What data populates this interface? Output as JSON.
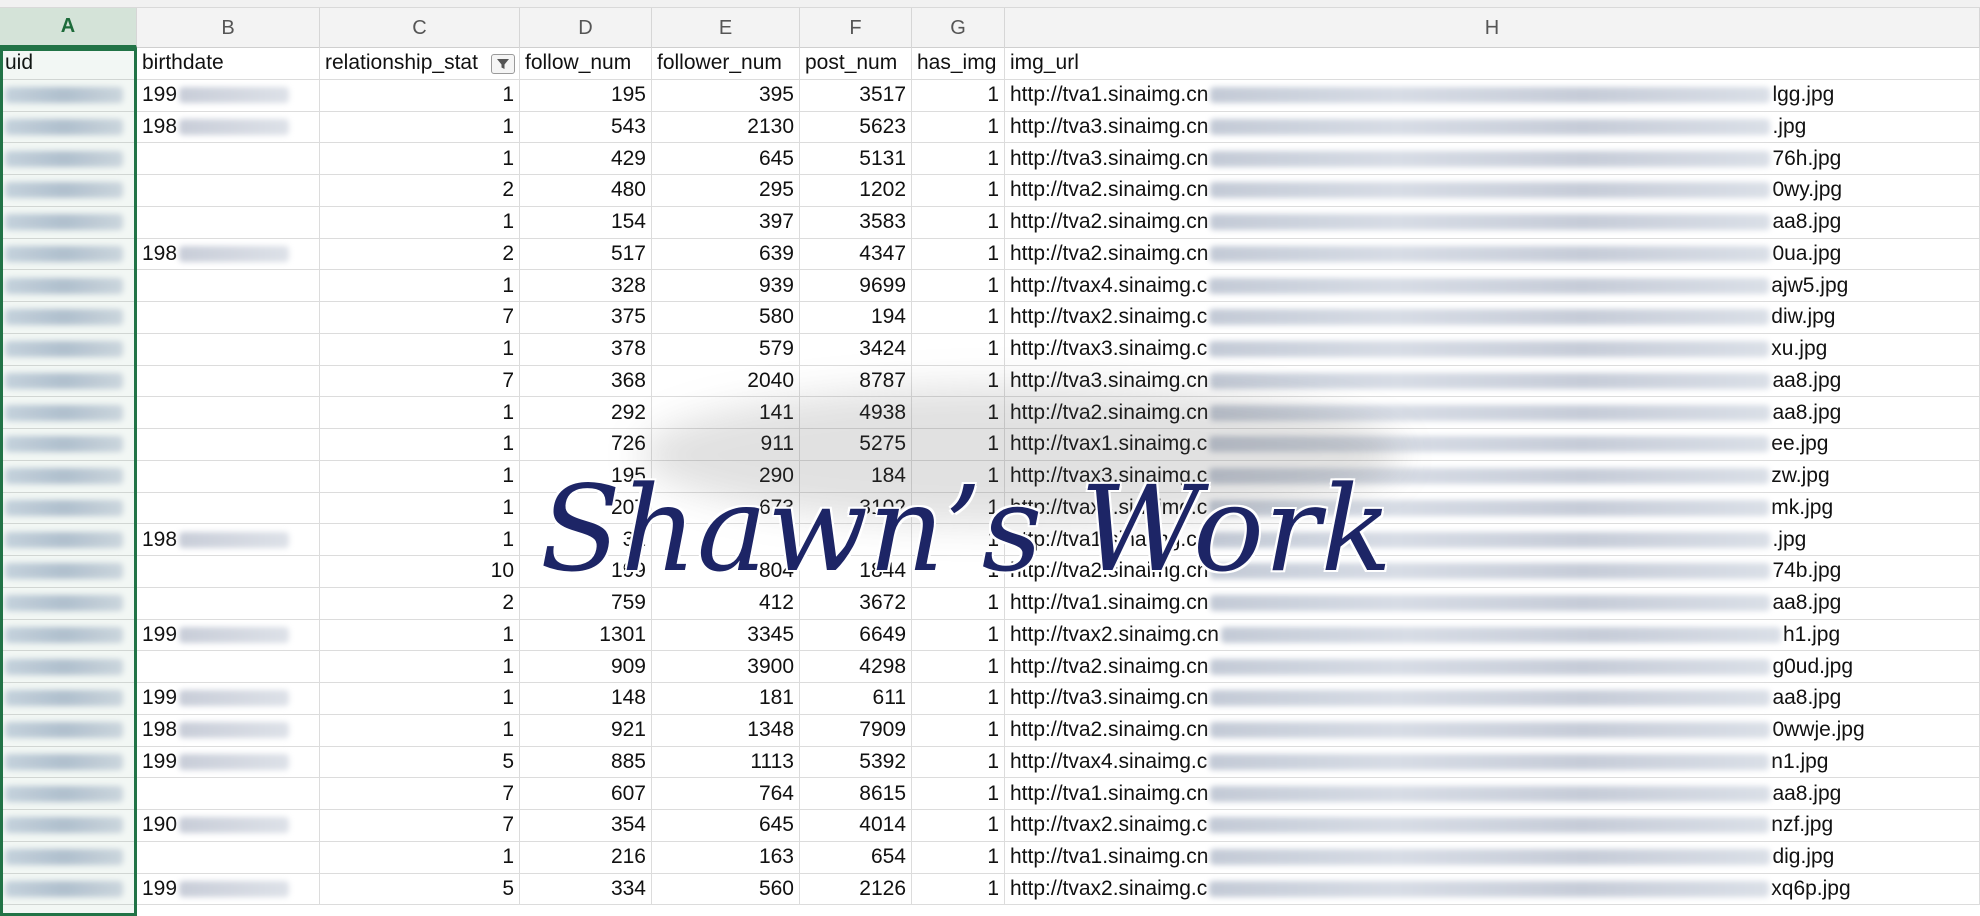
{
  "column_letters": [
    "A",
    "B",
    "C",
    "D",
    "E",
    "F",
    "G",
    "H"
  ],
  "headers": [
    "uid",
    "birthdate",
    "relationship_stat",
    "follow_num",
    "follower_num",
    "post_num",
    "has_img",
    "img_url"
  ],
  "rows": [
    {
      "birth": "199",
      "rel": "1",
      "follow": "195",
      "follower": "395",
      "post": "3517",
      "has_img": "1",
      "url_host": "http://tva1.sinaimg.cn",
      "url_tail": "lgg.jpg"
    },
    {
      "birth": "198",
      "rel": "1",
      "follow": "543",
      "follower": "2130",
      "post": "5623",
      "has_img": "1",
      "url_host": "http://tva3.sinaimg.cn",
      "url_tail": ".jpg"
    },
    {
      "birth": "",
      "rel": "1",
      "follow": "429",
      "follower": "645",
      "post": "5131",
      "has_img": "1",
      "url_host": "http://tva3.sinaimg.cn",
      "url_tail": "76h.jpg"
    },
    {
      "birth": "",
      "rel": "2",
      "follow": "480",
      "follower": "295",
      "post": "1202",
      "has_img": "1",
      "url_host": "http://tva2.sinaimg.cn",
      "url_tail": "0wy.jpg"
    },
    {
      "birth": "",
      "rel": "1",
      "follow": "154",
      "follower": "397",
      "post": "3583",
      "has_img": "1",
      "url_host": "http://tva2.sinaimg.cn",
      "url_tail": "aa8.jpg"
    },
    {
      "birth": "198",
      "rel": "2",
      "follow": "517",
      "follower": "639",
      "post": "4347",
      "has_img": "1",
      "url_host": "http://tva2.sinaimg.cn",
      "url_tail": "0ua.jpg"
    },
    {
      "birth": "",
      "rel": "1",
      "follow": "328",
      "follower": "939",
      "post": "9699",
      "has_img": "1",
      "url_host": "http://tvax4.sinaimg.c",
      "url_tail": "ajw5.jpg"
    },
    {
      "birth": "",
      "rel": "7",
      "follow": "375",
      "follower": "580",
      "post": "194",
      "has_img": "1",
      "url_host": "http://tvax2.sinaimg.c",
      "url_tail": "diw.jpg"
    },
    {
      "birth": "",
      "rel": "1",
      "follow": "378",
      "follower": "579",
      "post": "3424",
      "has_img": "1",
      "url_host": "http://tvax3.sinaimg.c",
      "url_tail": "xu.jpg"
    },
    {
      "birth": "",
      "rel": "7",
      "follow": "368",
      "follower": "2040",
      "post": "8787",
      "has_img": "1",
      "url_host": "http://tva3.sinaimg.cn",
      "url_tail": "aa8.jpg"
    },
    {
      "birth": "",
      "rel": "1",
      "follow": "292",
      "follower": "141",
      "post": "4938",
      "has_img": "1",
      "url_host": "http://tva2.sinaimg.cn",
      "url_tail": "aa8.jpg"
    },
    {
      "birth": "",
      "rel": "1",
      "follow": "726",
      "follower": "911",
      "post": "5275",
      "has_img": "1",
      "url_host": "http://tvax1.sinaimg.c",
      "url_tail": "ee.jpg"
    },
    {
      "birth": "",
      "rel": "1",
      "follow": "195",
      "follower": "290",
      "post": "184",
      "has_img": "1",
      "url_host": "http://tvax3.sinaimg.c",
      "url_tail": "zw.jpg"
    },
    {
      "birth": "",
      "rel": "1",
      "follow": "207",
      "follower": "673",
      "post": "3102",
      "has_img": "1",
      "url_host": "http://tvax4.sinaimg.c",
      "url_tail": "mk.jpg"
    },
    {
      "birth": "198",
      "rel": "1",
      "follow": "31",
      "follower": "",
      "post": "",
      "has_img": "1",
      "url_host": "http://tva1.sinaimg.cn",
      "url_tail": ".jpg"
    },
    {
      "birth": "",
      "rel": "10",
      "follow": "199",
      "follower": "804",
      "post": "1844",
      "has_img": "1",
      "url_host": "http://tva2.sinaimg.cn",
      "url_tail": "74b.jpg"
    },
    {
      "birth": "",
      "rel": "2",
      "follow": "759",
      "follower": "412",
      "post": "3672",
      "has_img": "1",
      "url_host": "http://tva1.sinaimg.cn",
      "url_tail": "aa8.jpg"
    },
    {
      "birth": "199",
      "rel": "1",
      "follow": "1301",
      "follower": "3345",
      "post": "6649",
      "has_img": "1",
      "url_host": "http://tvax2.sinaimg.cn",
      "url_tail": "h1.jpg"
    },
    {
      "birth": "",
      "rel": "1",
      "follow": "909",
      "follower": "3900",
      "post": "4298",
      "has_img": "1",
      "url_host": "http://tva2.sinaimg.cn",
      "url_tail": "g0ud.jpg"
    },
    {
      "birth": "199",
      "rel": "1",
      "follow": "148",
      "follower": "181",
      "post": "611",
      "has_img": "1",
      "url_host": "http://tva3.sinaimg.cn",
      "url_tail": "aa8.jpg"
    },
    {
      "birth": "198",
      "rel": "1",
      "follow": "921",
      "follower": "1348",
      "post": "7909",
      "has_img": "1",
      "url_host": "http://tva2.sinaimg.cn",
      "url_tail": "0wwje.jpg"
    },
    {
      "birth": "199",
      "rel": "5",
      "follow": "885",
      "follower": "1113",
      "post": "5392",
      "has_img": "1",
      "url_host": "http://tvax4.sinaimg.c",
      "url_tail": "n1.jpg"
    },
    {
      "birth": "",
      "rel": "7",
      "follow": "607",
      "follower": "764",
      "post": "8615",
      "has_img": "1",
      "url_host": "http://tva1.sinaimg.cn",
      "url_tail": "aa8.jpg"
    },
    {
      "birth": "190",
      "rel": "7",
      "follow": "354",
      "follower": "645",
      "post": "4014",
      "has_img": "1",
      "url_host": "http://tvax2.sinaimg.c",
      "url_tail": "nzf.jpg"
    },
    {
      "birth": "",
      "rel": "1",
      "follow": "216",
      "follower": "163",
      "post": "654",
      "has_img": "1",
      "url_host": "http://tva1.sinaimg.cn",
      "url_tail": "dig.jpg"
    },
    {
      "birth": "199",
      "rel": "5",
      "follow": "334",
      "follower": "560",
      "post": "2126",
      "has_img": "1",
      "url_host": "http://tvax2.sinaimg.c",
      "url_tail": "xq6p.jpg"
    }
  ],
  "watermark": "Shawn’s Work",
  "filter_icon": "filter-funnel-icon"
}
